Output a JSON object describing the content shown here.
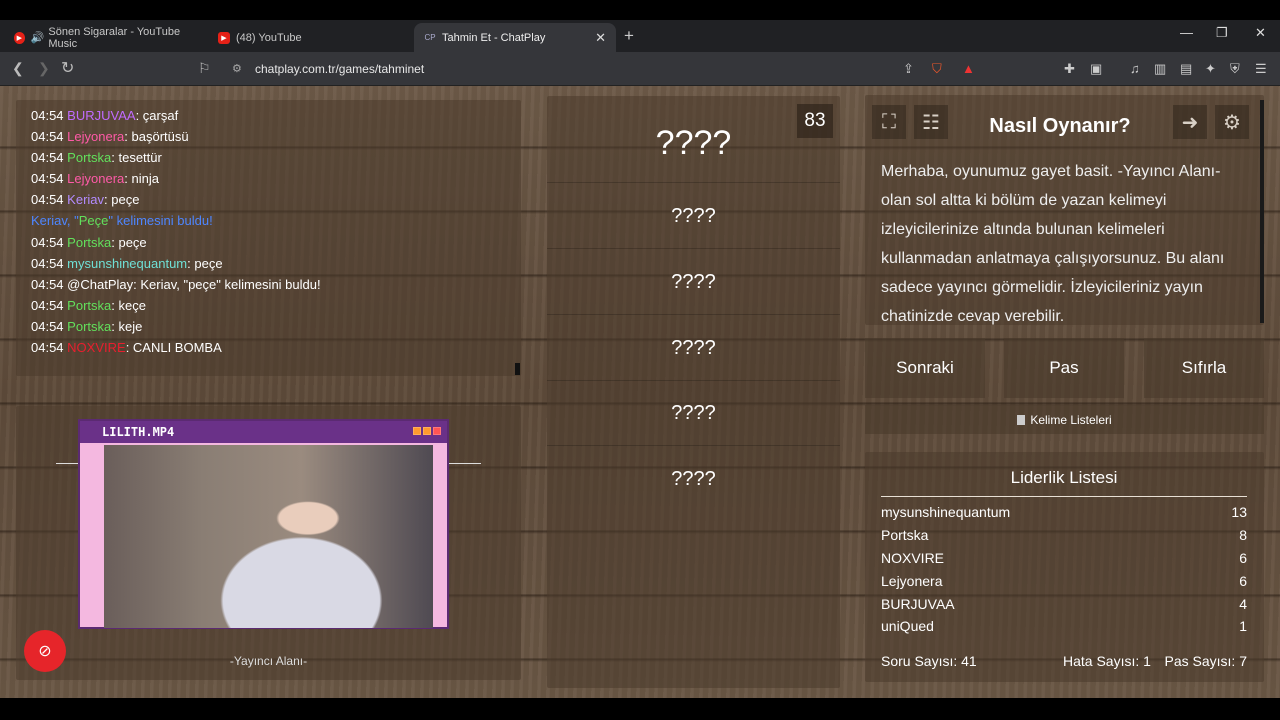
{
  "browser": {
    "tabs": [
      {
        "title": "Sönen Sigaralar - YouTube Music",
        "active": false
      },
      {
        "title": "(48) YouTube",
        "active": false
      },
      {
        "title": "Tahmin Et - ChatPlay",
        "active": true
      }
    ],
    "url": "chatplay.com.tr/games/tahminet"
  },
  "chat": {
    "messages": [
      {
        "time": "04:54",
        "user": "BURJUVAA",
        "user_color": "#c06bff",
        "text": ": çarşaf"
      },
      {
        "time": "04:54",
        "user": "Lejyonera",
        "user_color": "#ff5aa8",
        "text": ": başörtüsü"
      },
      {
        "time": "04:54",
        "user": "Portska",
        "user_color": "#62e05c",
        "text": ": tesettür"
      },
      {
        "time": "04:54",
        "user": "Lejyonera",
        "user_color": "#ff5aa8",
        "text": ": ninja"
      },
      {
        "time": "04:54",
        "user": "Keriav",
        "user_color": "#b38bff",
        "text": ": peçe"
      },
      {
        "system": true,
        "text_a": "Keriav, \"",
        "text_word": "Peçe",
        "text_b": "\" kelimesini buldu!"
      },
      {
        "time": "04:54",
        "user": "Portska",
        "user_color": "#62e05c",
        "text": ": peçe"
      },
      {
        "time": "04:54",
        "user": "mysunshinequantum",
        "user_color": "#6fe0d6",
        "text": ": peçe"
      },
      {
        "time": "04:54",
        "user": "@ChatPlay",
        "user_color": "#ffffff",
        "text": ": Keriav, \"peçe\" kelimesini buldu!"
      },
      {
        "time": "04:54",
        "user": "Portska",
        "user_color": "#62e05c",
        "text": ": keçe"
      },
      {
        "time": "04:54",
        "user": "Portska",
        "user_color": "#62e05c",
        "text": ": keje"
      },
      {
        "time": "04:54",
        "user": "NOXVIRE",
        "user_color": "#e81e2e",
        "text": ": CANLI BOMBA"
      }
    ]
  },
  "streamer": {
    "video_title": "LILITH.MP4",
    "label": "-Yayıncı Alanı-"
  },
  "words": {
    "counter": "83",
    "items": [
      "????",
      "????",
      "????",
      "????",
      "????",
      "????"
    ]
  },
  "howto": {
    "title": "Nasıl Oynanır?",
    "text": "Merhaba, oyunumuz gayet basit. -Yayıncı Alanı- olan sol altta ki bölüm de yazan kelimeyi izleyicilerinize altında bulunan kelimeleri kullanmadan anlatmaya çalışıyorsunuz. Bu alanı sadece yayıncı görmelidir. İzleyicileriniz yayın chatinizde cevap verebilir."
  },
  "actions": {
    "next": "Sonraki",
    "pass": "Pas",
    "reset": "Sıfırla",
    "word_lists": "Kelime Listeleri"
  },
  "leaderboard": {
    "title": "Liderlik Listesi",
    "rows": [
      {
        "name": "mysunshinequantum",
        "score": "13"
      },
      {
        "name": "Portska",
        "score": "8"
      },
      {
        "name": "NOXVIRE",
        "score": "6"
      },
      {
        "name": "Lejyonera",
        "score": "6"
      },
      {
        "name": "BURJUVAA",
        "score": "4"
      },
      {
        "name": "uniQued",
        "score": "1"
      }
    ],
    "questions": "Soru Sayısı: 41",
    "errors": "Hata Sayısı: 1",
    "passes": "Pas Sayısı: 7"
  }
}
